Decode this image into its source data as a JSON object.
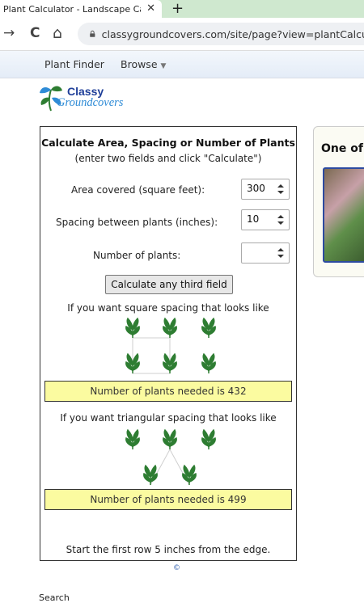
{
  "browser": {
    "tab_title": "Plant Calculator - Landscape Calc",
    "tab_close": "✕",
    "new_tab": "+",
    "back": "→",
    "reload": "C",
    "home": "⌂",
    "url": "classygroundcovers.com/site/page?view=plantCalcula"
  },
  "nav": {
    "plant_finder": "Plant Finder",
    "browse": "Browse"
  },
  "logo": {
    "line1": "Classy",
    "line2": "Groundcovers"
  },
  "calculator": {
    "title": "Calculate Area, Spacing or Number of Plants",
    "subtitle": "(enter two fields and click \"Calculate\")",
    "fields": [
      {
        "label": "Area covered (square feet):",
        "value": "300"
      },
      {
        "label": "Spacing between plants (inches):",
        "value": "10"
      },
      {
        "label": "Number of plants:",
        "value": ""
      }
    ],
    "button": "Calculate any third field",
    "square_hint": "If you want square spacing that looks like",
    "square_result": "Number of plants needed is 432",
    "triangular_hint": "If you want triangular spacing that looks like",
    "triangular_result": "Number of plants needed is 499",
    "footer": "Start the first row 5 inches from the edge."
  },
  "side_panel": {
    "title": "One of"
  },
  "copyright": "©",
  "bottom_text": "Search",
  "colors": {
    "accent_green": "#2e7d32",
    "result_bg": "#fbfba0",
    "link_blue": "#2255aa"
  }
}
